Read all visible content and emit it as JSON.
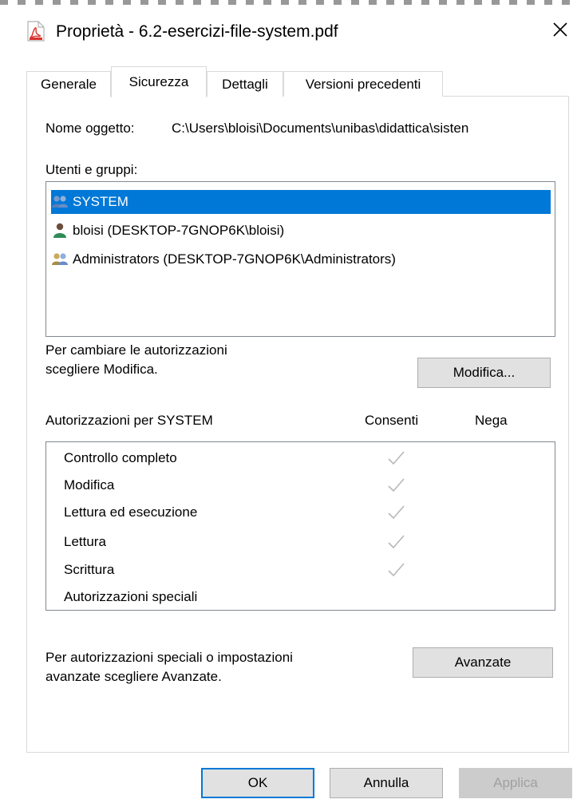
{
  "window": {
    "title": "Proprietà - 6.2-esercizi-file-system.pdf",
    "icon": "pdf-file-icon",
    "close_glyph": "✕"
  },
  "tabs": [
    {
      "label": "Generale",
      "active": false
    },
    {
      "label": "Sicurezza",
      "active": true
    },
    {
      "label": "Dettagli",
      "active": false
    },
    {
      "label": "Versioni precedenti",
      "active": false
    }
  ],
  "security": {
    "object_name_label": "Nome oggetto:",
    "object_name_value": "C:\\Users\\bloisi\\Documents\\unibas\\didattica\\sisten",
    "groups_label": "Utenti e gruppi:",
    "users": [
      {
        "name": "SYSTEM",
        "icon": "users-group-icon",
        "selected": true
      },
      {
        "name": "bloisi (DESKTOP-7GNOP6K\\bloisi)",
        "icon": "user-icon",
        "selected": false
      },
      {
        "name": "Administrators (DESKTOP-7GNOP6K\\Administrators)",
        "icon": "users-group-icon",
        "selected": false
      }
    ],
    "change_hint_line1": "Per cambiare le autorizzazioni",
    "change_hint_line2": "scegliere Modifica.",
    "edit_button": "Modifica...",
    "permissions_for": "Autorizzazioni per SYSTEM",
    "col_allow": "Consenti",
    "col_deny": "Nega",
    "permissions": [
      {
        "name": "Controllo completo",
        "allow": true,
        "deny": false
      },
      {
        "name": "Modifica",
        "allow": true,
        "deny": false
      },
      {
        "name": "Lettura ed esecuzione",
        "allow": true,
        "deny": false
      },
      {
        "name": "Lettura",
        "allow": true,
        "deny": false
      },
      {
        "name": "Scrittura",
        "allow": true,
        "deny": false
      },
      {
        "name": "Autorizzazioni speciali",
        "allow": false,
        "deny": false
      }
    ],
    "advanced_hint_line1": "Per autorizzazioni speciali o impostazioni",
    "advanced_hint_line2": "avanzate scegliere Avanzate.",
    "advanced_button": "Avanzate"
  },
  "footer": {
    "ok": "OK",
    "cancel": "Annulla",
    "apply": "Applica"
  },
  "colors": {
    "selection": "#0078d7",
    "check": "#b8b8b8"
  }
}
